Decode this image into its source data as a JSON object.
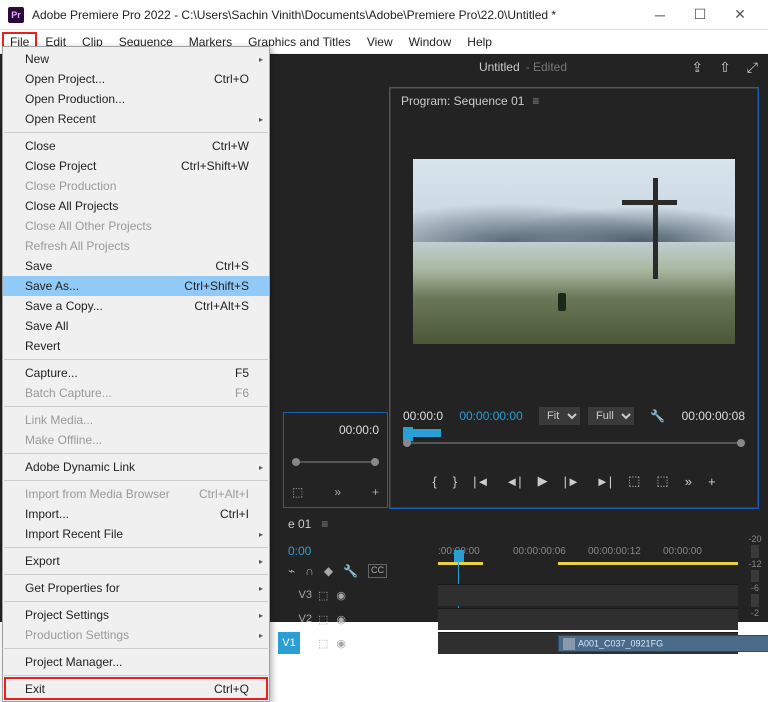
{
  "window": {
    "app_icon_text": "Pr",
    "title": "Adobe Premiere Pro 2022 - C:\\Users\\Sachin Vinith\\Documents\\Adobe\\Premiere Pro\\22.0\\Untitled *"
  },
  "menubar": [
    "File",
    "Edit",
    "Clip",
    "Sequence",
    "Markers",
    "Graphics and Titles",
    "View",
    "Window",
    "Help"
  ],
  "file_menu": {
    "groups": [
      [
        {
          "label": "New",
          "shortcut": "",
          "sub": true
        },
        {
          "label": "Open Project...",
          "shortcut": "Ctrl+O"
        },
        {
          "label": "Open Production..."
        },
        {
          "label": "Open Recent",
          "sub": true
        }
      ],
      [
        {
          "label": "Close",
          "shortcut": "Ctrl+W"
        },
        {
          "label": "Close Project",
          "shortcut": "Ctrl+Shift+W"
        },
        {
          "label": "Close Production",
          "disabled": true
        },
        {
          "label": "Close All Projects"
        },
        {
          "label": "Close All Other Projects",
          "disabled": true
        },
        {
          "label": "Refresh All Projects",
          "disabled": true
        },
        {
          "label": "Save",
          "shortcut": "Ctrl+S"
        },
        {
          "label": "Save As...",
          "shortcut": "Ctrl+Shift+S",
          "hover": true
        },
        {
          "label": "Save a Copy...",
          "shortcut": "Ctrl+Alt+S"
        },
        {
          "label": "Save All"
        },
        {
          "label": "Revert"
        }
      ],
      [
        {
          "label": "Capture...",
          "shortcut": "F5"
        },
        {
          "label": "Batch Capture...",
          "shortcut": "F6",
          "disabled": true
        }
      ],
      [
        {
          "label": "Link Media...",
          "disabled": true
        },
        {
          "label": "Make Offline...",
          "disabled": true
        }
      ],
      [
        {
          "label": "Adobe Dynamic Link",
          "sub": true
        }
      ],
      [
        {
          "label": "Import from Media Browser",
          "shortcut": "Ctrl+Alt+I",
          "disabled": true
        },
        {
          "label": "Import...",
          "shortcut": "Ctrl+I"
        },
        {
          "label": "Import Recent File",
          "sub": true
        }
      ],
      [
        {
          "label": "Export",
          "sub": true
        }
      ],
      [
        {
          "label": "Get Properties for",
          "sub": true
        }
      ],
      [
        {
          "label": "Project Settings",
          "sub": true
        },
        {
          "label": "Production Settings",
          "disabled": true,
          "sub": true
        }
      ],
      [
        {
          "label": "Project Manager..."
        }
      ],
      [
        {
          "label": "Exit",
          "shortcut": "Ctrl+Q",
          "boxed": true
        }
      ]
    ]
  },
  "topbar": {
    "doc": "Untitled",
    "status": "- Edited"
  },
  "program": {
    "title": "Program: Sequence 01",
    "tc_left": "00:00:0",
    "tc_main": "00:00:00:00",
    "fit": "Fit",
    "full": "Full",
    "tc_right": "00:00:00:08"
  },
  "left_block": {
    "tc": "00:00:0"
  },
  "timeline": {
    "seq_label": "e 01",
    "ruler_current": "0:00",
    "ruler": [
      ":00:00:00",
      "00:00:00:06",
      "00:00:00:12",
      "00:00:00"
    ],
    "tracks": {
      "v3": "V3",
      "v2": "V2",
      "v1": "V1"
    },
    "clip_name": "A001_C037_0921FG"
  }
}
